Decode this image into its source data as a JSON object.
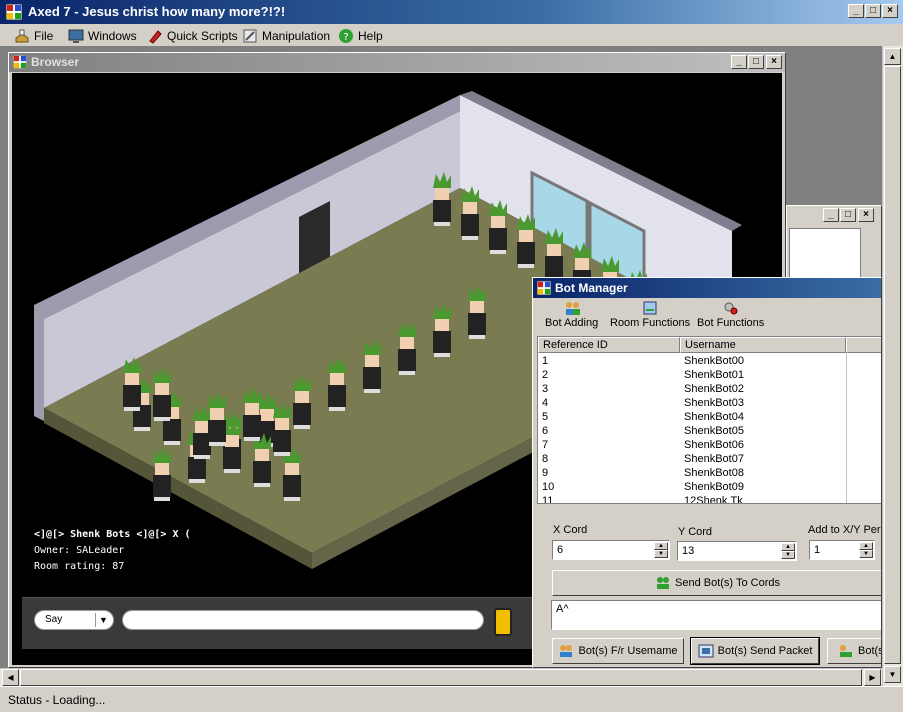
{
  "window": {
    "title": "Axed 7 - Jesus christ how many more?!?!"
  },
  "menu": [
    {
      "label": "File",
      "icon": "file-icon"
    },
    {
      "label": "Windows",
      "icon": "monitor-icon"
    },
    {
      "label": "Quick Scripts",
      "icon": "script-icon"
    },
    {
      "label": "Manipulation",
      "icon": "manipulation-icon"
    },
    {
      "label": "Help",
      "icon": "help-icon"
    }
  ],
  "browser": {
    "title": "Browser",
    "room": {
      "name": "<]@[> Shenk Bots <]@[> X (",
      "owner": "Owner: SALeader",
      "rating": "Room rating: 87"
    },
    "chat": {
      "mode": "Say"
    }
  },
  "bot_manager": {
    "title": "Bot Manager",
    "toolbar": [
      "Bot Adding",
      "Room Functions",
      "Bot Functions"
    ],
    "columns": [
      "Reference ID",
      "Username"
    ],
    "rows": [
      [
        "1",
        "ShenkBot00"
      ],
      [
        "2",
        "ShenkBot01"
      ],
      [
        "3",
        "ShenkBot02"
      ],
      [
        "4",
        "ShenkBot03"
      ],
      [
        "5",
        "ShenkBot04"
      ],
      [
        "6",
        "ShenkBot05"
      ],
      [
        "7",
        "ShenkBot06"
      ],
      [
        "8",
        "ShenkBot07"
      ],
      [
        "9",
        "ShenkBot08"
      ],
      [
        "10",
        "ShenkBot09"
      ],
      [
        "11",
        "12Shenk.Tk"
      ]
    ],
    "x_cord": {
      "label": "X Cord",
      "value": "6"
    },
    "y_cord": {
      "label": "Y Cord",
      "value": "13"
    },
    "add_xy": {
      "label": "Add to X/Y Per",
      "value": "1"
    },
    "send_to_cords": "Send Bot(s) To Cords",
    "packet_text": "A^",
    "follow_user": "Bot(s) F/r Usemame",
    "send_packet": "Bot(s) Send Packet",
    "third_button": "Bot(s"
  },
  "status": {
    "text": "Status -  Loading..."
  }
}
